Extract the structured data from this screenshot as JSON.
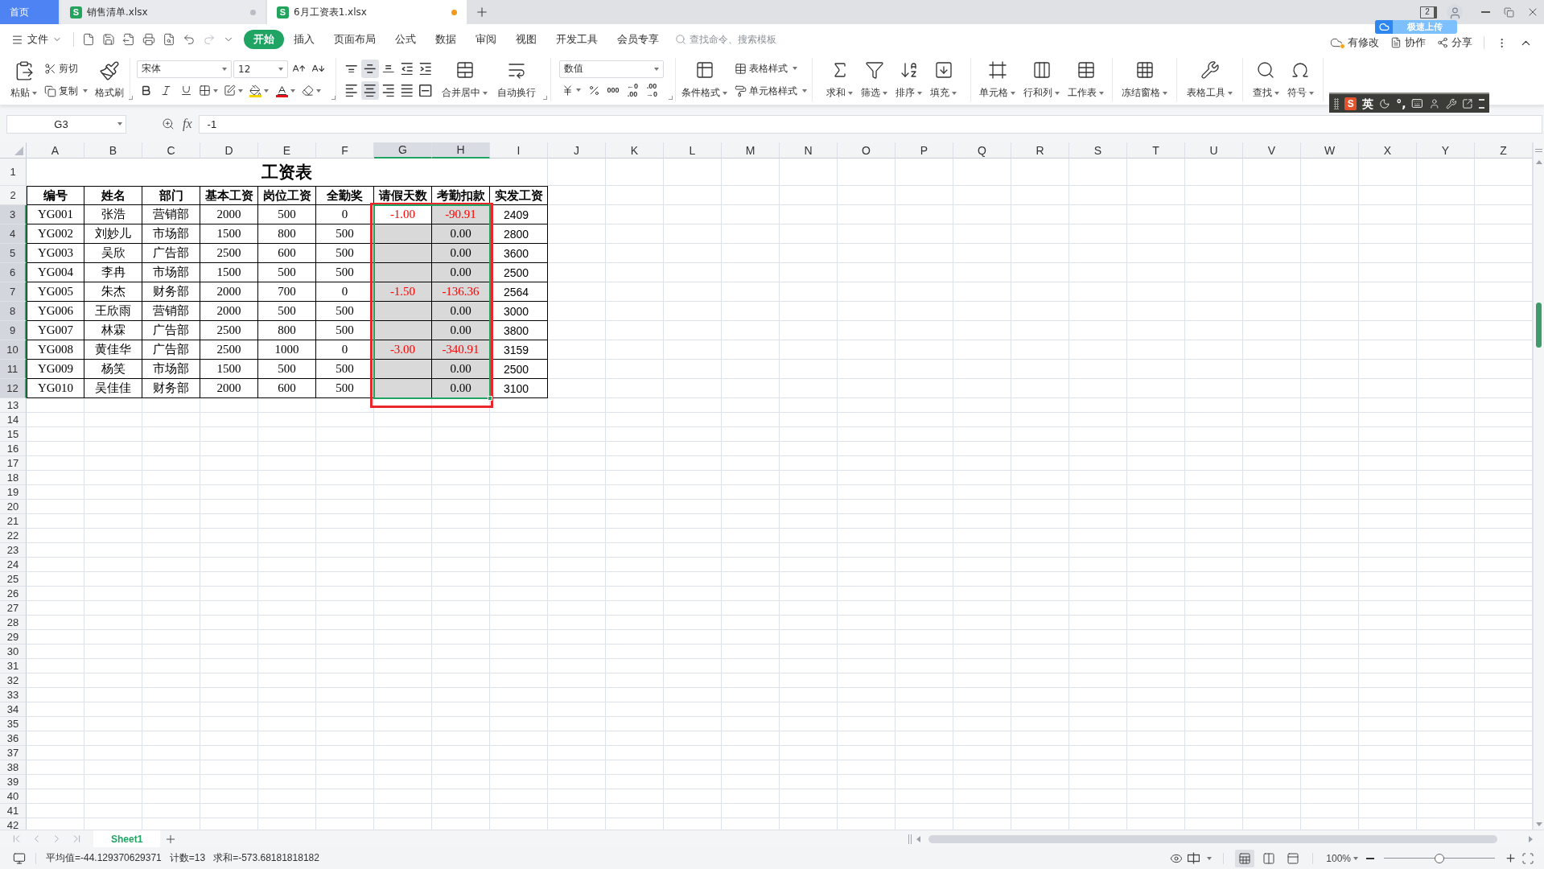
{
  "tabs": [
    {
      "kind": "home",
      "label": "首页",
      "selected": false
    },
    {
      "kind": "file",
      "badge": "S",
      "label": "销售清单.xlsx",
      "selected": false,
      "modified": false
    },
    {
      "kind": "file",
      "badge": "S",
      "label": "6月工资表1.xlsx",
      "selected": true,
      "modified": true
    }
  ],
  "window": {
    "window_count": "2"
  },
  "upload_popup": {
    "label": "极速上传"
  },
  "menu": {
    "file": "文件",
    "tabs": [
      {
        "label": "开始",
        "selected": true
      },
      {
        "label": "插入",
        "selected": false
      },
      {
        "label": "页面布局",
        "selected": false
      },
      {
        "label": "公式",
        "selected": false
      },
      {
        "label": "数据",
        "selected": false
      },
      {
        "label": "审阅",
        "selected": false
      },
      {
        "label": "视图",
        "selected": false
      },
      {
        "label": "开发工具",
        "selected": false
      },
      {
        "label": "会员专享",
        "selected": false
      }
    ],
    "search": {
      "placeholder": "查找命令、搜索模板"
    },
    "cloud_status": "有修改",
    "collaborate": "协作",
    "share": "分享"
  },
  "ribbon": {
    "paste": "粘贴",
    "cut": "剪切",
    "copy": "复制",
    "format_painter": "格式刷",
    "font_family": "宋体",
    "font_size": "12",
    "alignment": [
      {
        "kind": "top",
        "selected": false
      },
      {
        "kind": "middle",
        "selected": true
      },
      {
        "kind": "bottom",
        "selected": false
      },
      {
        "kind": "outdent",
        "selected": false
      },
      {
        "kind": "indent",
        "selected": false
      },
      {
        "kind": "left",
        "selected": false
      },
      {
        "kind": "center",
        "selected": true
      },
      {
        "kind": "right",
        "selected": false
      },
      {
        "kind": "justify",
        "selected": false
      },
      {
        "kind": "distributed",
        "selected": false
      }
    ],
    "merge_center": "合并居中",
    "wrap_text": "自动换行",
    "number_format": "数值",
    "number_buttons": [
      {
        "kind": "currency"
      },
      {
        "kind": "percent"
      },
      {
        "kind": "thousands",
        "lines": [
          "000"
        ]
      },
      {
        "kind": "add_decimal",
        "lines": [
          "←0",
          ".00"
        ]
      },
      {
        "kind": "remove_decimal",
        "lines": [
          ".00",
          "→0"
        ]
      }
    ],
    "conditional_format": "条件格式",
    "table_style": "表格样式",
    "cell_style": "单元格样式",
    "tool_groups": [
      [
        {
          "kind": "sum",
          "label": "求和"
        },
        {
          "kind": "filter",
          "label": "筛选"
        },
        {
          "kind": "sort",
          "label": "排序"
        },
        {
          "kind": "fill",
          "label": "填充"
        }
      ],
      [
        {
          "kind": "cell",
          "label": "单元格"
        },
        {
          "kind": "rowcol",
          "label": "行和列"
        },
        {
          "kind": "sheet",
          "label": "工作表"
        }
      ],
      [
        {
          "kind": "freeze",
          "label": "冻结窗格"
        }
      ],
      [
        {
          "kind": "tools",
          "label": "表格工具"
        }
      ],
      [
        {
          "kind": "find",
          "label": "查找"
        },
        {
          "kind": "symbol",
          "label": "符号"
        }
      ]
    ]
  },
  "ime_toolbar": {
    "logo": "S",
    "mode": "英",
    "punctuation": "°,"
  },
  "formula_bar": {
    "name_box": "G3",
    "fx": "fx",
    "formula": "-1"
  },
  "sheet": {
    "columns": [
      {
        "label": "A",
        "selected": false
      },
      {
        "label": "B",
        "selected": false
      },
      {
        "label": "C",
        "selected": false
      },
      {
        "label": "D",
        "selected": false
      },
      {
        "label": "E",
        "selected": false
      },
      {
        "label": "F",
        "selected": false
      },
      {
        "label": "G",
        "selected": true
      },
      {
        "label": "H",
        "selected": true
      },
      {
        "label": "I",
        "selected": false
      },
      {
        "label": "J",
        "selected": false
      },
      {
        "label": "K",
        "selected": false
      },
      {
        "label": "L",
        "selected": false
      },
      {
        "label": "M",
        "selected": false
      },
      {
        "label": "N",
        "selected": false
      },
      {
        "label": "O",
        "selected": false
      },
      {
        "label": "P",
        "selected": false
      },
      {
        "label": "Q",
        "selected": false
      },
      {
        "label": "R",
        "selected": false
      },
      {
        "label": "S",
        "selected": false
      },
      {
        "label": "T",
        "selected": false
      },
      {
        "label": "U",
        "selected": false
      },
      {
        "label": "V",
        "selected": false
      },
      {
        "label": "W",
        "selected": false
      },
      {
        "label": "X",
        "selected": false
      },
      {
        "label": "Y",
        "selected": false
      },
      {
        "label": "Z",
        "selected": false
      }
    ],
    "rows": [
      {
        "label": "1",
        "selected": false
      },
      {
        "label": "2",
        "selected": false
      },
      {
        "label": "3",
        "selected": true
      },
      {
        "label": "4",
        "selected": true
      },
      {
        "label": "5",
        "selected": true
      },
      {
        "label": "6",
        "selected": true
      },
      {
        "label": "7",
        "selected": true
      },
      {
        "label": "8",
        "selected": true
      },
      {
        "label": "9",
        "selected": true
      },
      {
        "label": "10",
        "selected": true
      },
      {
        "label": "11",
        "selected": true
      },
      {
        "label": "12",
        "selected": true
      },
      {
        "label": "13",
        "selected": false
      },
      {
        "label": "14",
        "selected": false
      },
      {
        "label": "15",
        "selected": false
      },
      {
        "label": "16",
        "selected": false
      },
      {
        "label": "17",
        "selected": false
      },
      {
        "label": "18",
        "selected": false
      },
      {
        "label": "19",
        "selected": false
      },
      {
        "label": "20",
        "selected": false
      },
      {
        "label": "21",
        "selected": false
      },
      {
        "label": "22",
        "selected": false
      },
      {
        "label": "23",
        "selected": false
      },
      {
        "label": "24",
        "selected": false
      },
      {
        "label": "25",
        "selected": false
      },
      {
        "label": "26",
        "selected": false
      },
      {
        "label": "27",
        "selected": false
      },
      {
        "label": "28",
        "selected": false
      },
      {
        "label": "29",
        "selected": false
      },
      {
        "label": "30",
        "selected": false
      },
      {
        "label": "31",
        "selected": false
      },
      {
        "label": "32",
        "selected": false
      },
      {
        "label": "33",
        "selected": false
      },
      {
        "label": "34",
        "selected": false
      },
      {
        "label": "35",
        "selected": false
      },
      {
        "label": "36",
        "selected": false
      },
      {
        "label": "37",
        "selected": false
      },
      {
        "label": "38",
        "selected": false
      },
      {
        "label": "39",
        "selected": false
      },
      {
        "label": "40",
        "selected": false
      },
      {
        "label": "41",
        "selected": false
      },
      {
        "label": "42",
        "selected": false
      }
    ],
    "title": "工资表",
    "headers": [
      "编号",
      "姓名",
      "部门",
      "基本工资",
      "岗位工资",
      "全勤奖",
      "请假天数",
      "考勤扣款",
      "实发工资"
    ],
    "records": [
      {
        "id": "YG001",
        "name": "张浩",
        "department": "营销部",
        "base_pay": "2000",
        "post_pay": "500",
        "bonus": "0",
        "leave_days": {
          "value": "-1.00",
          "negative": true
        },
        "deduction": {
          "value": "-90.91",
          "negative": true
        },
        "net_pay": "2409"
      },
      {
        "id": "YG002",
        "name": "刘妙儿",
        "department": "市场部",
        "base_pay": "1500",
        "post_pay": "800",
        "bonus": "500",
        "deduction": {
          "value": "0.00",
          "negative": false
        },
        "net_pay": "2800"
      },
      {
        "id": "YG003",
        "name": "吴欣",
        "department": "广告部",
        "base_pay": "2500",
        "post_pay": "600",
        "bonus": "500",
        "deduction": {
          "value": "0.00",
          "negative": false
        },
        "net_pay": "3600"
      },
      {
        "id": "YG004",
        "name": "李冉",
        "department": "市场部",
        "base_pay": "1500",
        "post_pay": "500",
        "bonus": "500",
        "deduction": {
          "value": "0.00",
          "negative": false
        },
        "net_pay": "2500"
      },
      {
        "id": "YG005",
        "name": "朱杰",
        "department": "财务部",
        "base_pay": "2000",
        "post_pay": "700",
        "bonus": "0",
        "leave_days": {
          "value": "-1.50",
          "negative": true
        },
        "deduction": {
          "value": "-136.36",
          "negative": true
        },
        "net_pay": "2564"
      },
      {
        "id": "YG006",
        "name": "王欣雨",
        "department": "营销部",
        "base_pay": "2000",
        "post_pay": "500",
        "bonus": "500",
        "deduction": {
          "value": "0.00",
          "negative": false
        },
        "net_pay": "3000"
      },
      {
        "id": "YG007",
        "name": "林霖",
        "department": "广告部",
        "base_pay": "2500",
        "post_pay": "800",
        "bonus": "500",
        "deduction": {
          "value": "0.00",
          "negative": false
        },
        "net_pay": "3800"
      },
      {
        "id": "YG008",
        "name": "黄佳华",
        "department": "广告部",
        "base_pay": "2500",
        "post_pay": "1000",
        "bonus": "0",
        "leave_days": {
          "value": "-3.00",
          "negative": true
        },
        "deduction": {
          "value": "-340.91",
          "negative": true
        },
        "net_pay": "3159"
      },
      {
        "id": "YG009",
        "name": "杨笑",
        "department": "市场部",
        "base_pay": "1500",
        "post_pay": "500",
        "bonus": "500",
        "deduction": {
          "value": "0.00",
          "negative": false
        },
        "net_pay": "2500"
      },
      {
        "id": "YG010",
        "name": "吴佳佳",
        "department": "财务部",
        "base_pay": "2000",
        "post_pay": "600",
        "bonus": "500",
        "deduction": {
          "value": "0.00",
          "negative": false
        },
        "net_pay": "3100"
      }
    ],
    "annotations": [
      {
        "kind": "rectangle"
      }
    ]
  },
  "sheet_tabs": [
    {
      "label": "Sheet1",
      "selected": true
    }
  ],
  "status_bar": {
    "average": "平均值=-44.129370629371",
    "count": "计数=13",
    "sum": "求和=-573.68181818182",
    "views": [
      {
        "kind": "normal",
        "selected": true
      },
      {
        "kind": "page_layout",
        "selected": false
      },
      {
        "kind": "page_break",
        "selected": false
      }
    ],
    "zoom": "100%",
    "zoom_slider": {
      "level": 0.5
    }
  }
}
